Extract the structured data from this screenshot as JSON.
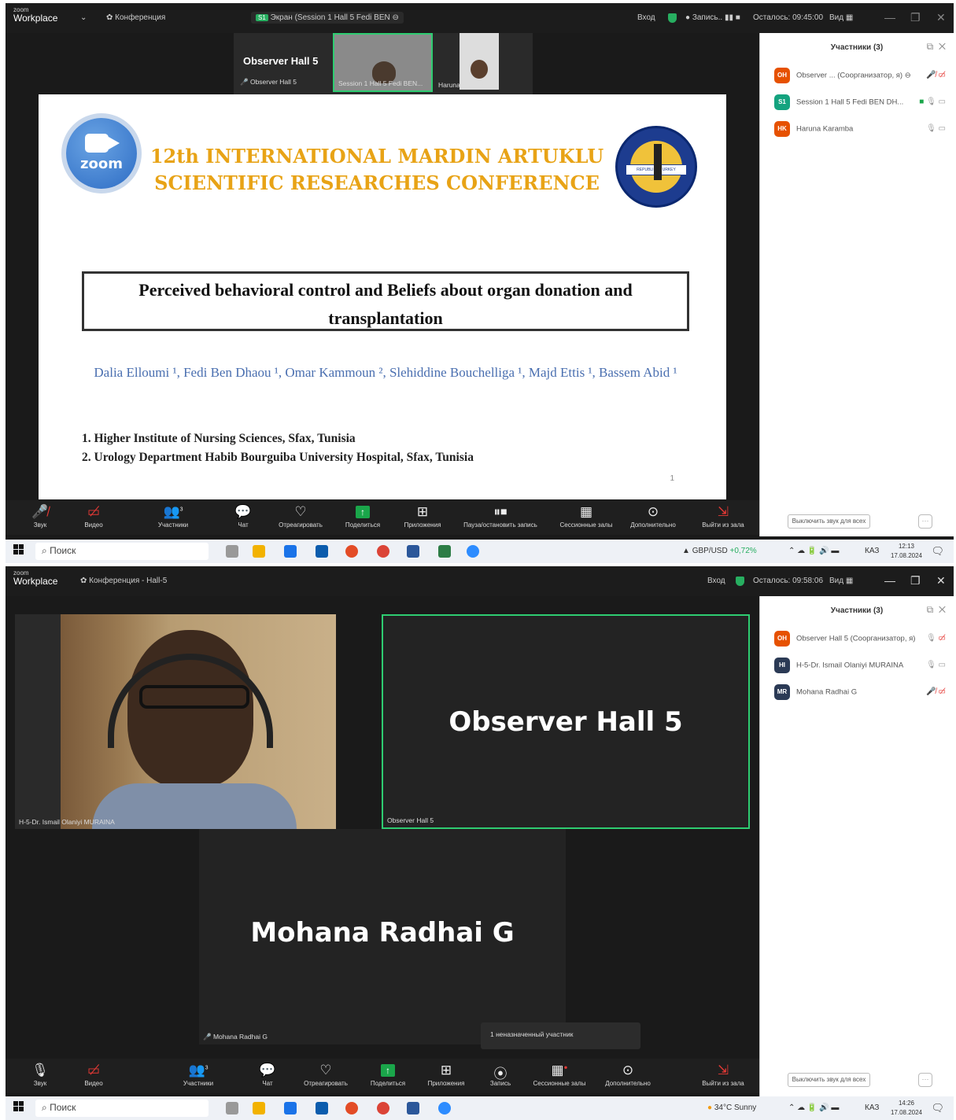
{
  "app": {
    "logo_small": "zoom",
    "logo_name": "Workplace",
    "window_controls": [
      "—",
      "❐",
      "✕"
    ]
  },
  "screen1": {
    "title": {
      "meeting_menu": "Конференция",
      "share_badge": "S1",
      "share_label": "Экран (Session 1 Hall 5 Fedi BEN ⊖",
      "login": "Вход",
      "recording": "Запись.. ▮▮ ■",
      "time_left": "Осталось: 09:45:00",
      "view": "Вид ▦"
    },
    "strip": {
      "observer_name": "Observer Hall 5",
      "observer_sub": "Observer Hall 5",
      "session_label": "Session 1 Hall 5 Fedi BEN...",
      "haruna_label": "Haruna Karamba"
    },
    "slide": {
      "logo_text": "zoom",
      "conference_line1": "12th INTERNATIONAL MARDIN ARTUKLU",
      "conference_line2": "SCIENTIFIC RESEARCHES CONFERENCE",
      "seal_text": "REPUBLIC · TURKEY",
      "paper_title": "Perceived behavioral control and Beliefs about organ donation and transplantation",
      "authors": "Dalia Elloumi ¹, Fedi Ben Dhaou ¹, Omar Kammoun ², Slehiddine Bouchelliga ¹, Majd Ettis ¹, Bassem Abid ¹",
      "affil_1": "1.  Higher Institute of Nursing Sciences, Sfax, Tunisia",
      "affil_2": "2.  Urology Department Habib Bourguiba University Hospital, Sfax, Tunisia",
      "page_number": "1"
    },
    "panel": {
      "title": "Участники (3)",
      "participants": [
        {
          "initials": "OH",
          "color": "#e65100",
          "name": "Observer ... (Соорганизатор, я) ⊖"
        },
        {
          "initials": "S1",
          "color": "#14a37f",
          "name": "Session 1 Hall 5 Fedi BEN DH..."
        },
        {
          "initials": "HK",
          "color": "#e65100",
          "name": "Haruna Karamba"
        }
      ],
      "mute_all": "Выключить звук для всех",
      "more": "···"
    },
    "toolbar": {
      "audio": "Звук",
      "video": "Видео",
      "participants": "Участники",
      "participants_count": "3",
      "chat": "Чат",
      "react": "Отреагировать",
      "share": "Поделиться",
      "apps": "Приложения",
      "pause_rec": "Пауза/остановить запись",
      "rooms": "Сессионные залы",
      "more": "Дополнительно",
      "leave": "Выйти из зала"
    },
    "taskbar": {
      "search": "Поиск",
      "ticker": "GBP/USD",
      "ticker_change": "+0,72%",
      "lang": "КАЗ",
      "time": "12:13",
      "date": "17.08.2024"
    }
  },
  "screen2": {
    "title": {
      "meeting_menu": "Конференция - Hall-5",
      "login": "Вход",
      "time_left": "Осталось: 09:58:06",
      "view": "Вид ▦"
    },
    "tiles": {
      "ismail_label": "H-5-Dr. Ismail Olaniyi MURAINA",
      "observer_big": "Observer Hall 5",
      "observer_label": "Observer Hall 5",
      "mohana_big": "Mohana Radhai G",
      "mohana_label": "Mohana Radhai G"
    },
    "tooltip": "1 неназначенный участник",
    "panel": {
      "title": "Участники (3)",
      "participants": [
        {
          "initials": "OH",
          "color": "#e65100",
          "name": "Observer Hall 5 (Соорганизатор, я)"
        },
        {
          "initials": "HI",
          "color": "#2b3a55",
          "name": "H-5-Dr. Ismail Olaniyi MURAINA"
        },
        {
          "initials": "MR",
          "color": "#2b3a55",
          "name": "Mohana Radhai G"
        }
      ],
      "mute_all": "Выключить звук для всех",
      "more": "···"
    },
    "toolbar": {
      "audio": "Звук",
      "video": "Видео",
      "participants": "Участники",
      "participants_count": "3",
      "chat": "Чат",
      "react": "Отреагировать",
      "share": "Поделиться",
      "apps": "Приложения",
      "record": "Запись",
      "rooms": "Сессионные залы",
      "more": "Дополнительно",
      "leave": "Выйти из зала"
    },
    "taskbar": {
      "search": "Поиск",
      "weather": "34°C  Sunny",
      "lang": "КАЗ",
      "time": "14:26",
      "date": "17.08.2024"
    }
  }
}
